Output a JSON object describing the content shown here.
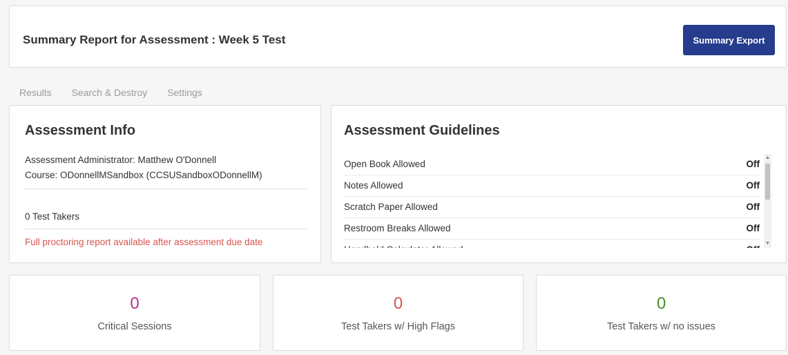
{
  "header": {
    "title": "Summary Report for Assessment : Week 5 Test",
    "export_label": "Summary Export"
  },
  "tabs": [
    {
      "label": "Results"
    },
    {
      "label": "Search & Destroy"
    },
    {
      "label": "Settings"
    }
  ],
  "info": {
    "heading": "Assessment Info",
    "administrator": "Assessment Administrator: Matthew O'Donnell",
    "course": "Course: ODonnellMSandbox (CCSUSandboxODonnellM)",
    "test_takers": "0 Test Takers",
    "notice": "Full proctoring report available after assessment due date"
  },
  "guidelines": {
    "heading": "Assessment Guidelines",
    "items": [
      {
        "label": "Open Book Allowed",
        "value": "Off"
      },
      {
        "label": "Notes Allowed",
        "value": "Off"
      },
      {
        "label": "Scratch Paper Allowed",
        "value": "Off"
      },
      {
        "label": "Restroom Breaks Allowed",
        "value": "Off"
      },
      {
        "label": "Handheld Calculator Allowed",
        "value": "Off"
      }
    ]
  },
  "stats": [
    {
      "value": "0",
      "label": "Critical Sessions",
      "color": "#b5338a"
    },
    {
      "value": "0",
      "label": "Test Takers w/ High Flags",
      "color": "#d9534f"
    },
    {
      "value": "0",
      "label": "Test Takers w/ no issues",
      "color": "#4a8c2a"
    }
  ],
  "colors": {
    "accent": "#253d8c",
    "warning": "#d9534f"
  }
}
